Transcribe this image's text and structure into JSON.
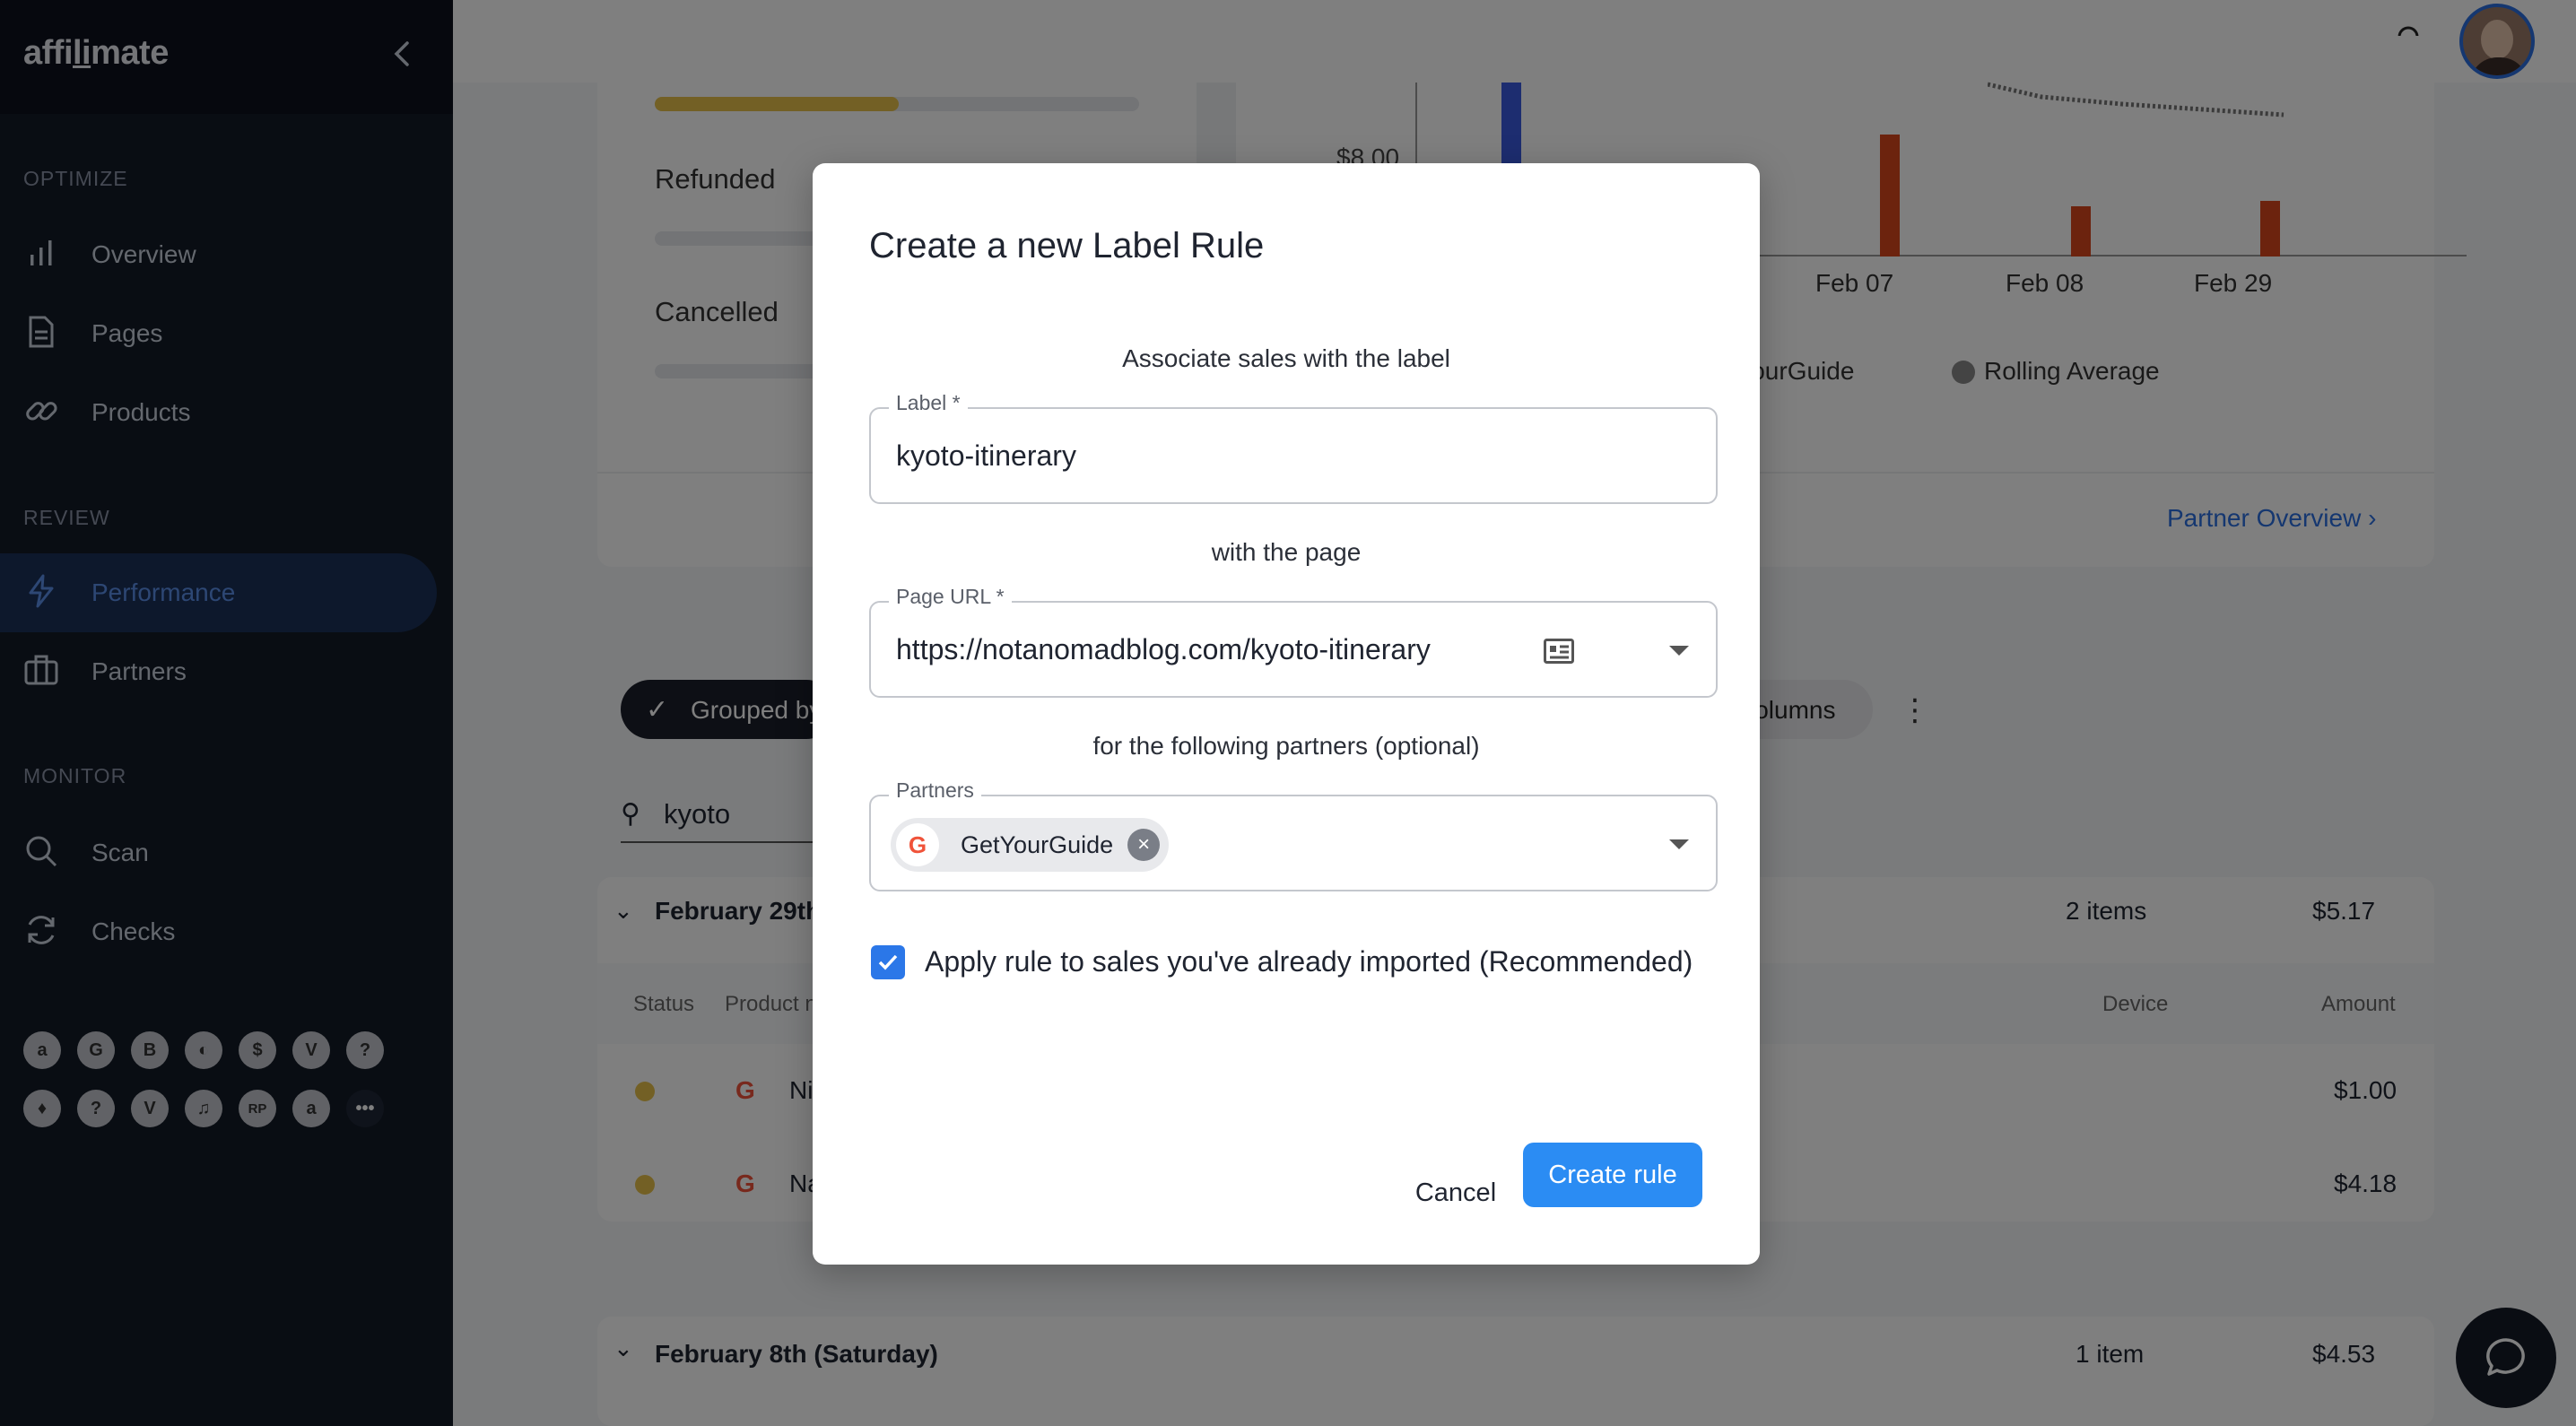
{
  "app": {
    "logo_prefix": "affi",
    "logo_underline": "li",
    "logo_suffix": "mate"
  },
  "sidebar": {
    "sections": [
      {
        "title": "OPTIMIZE",
        "items": [
          {
            "label": "Overview",
            "icon": "bar-chart-icon"
          },
          {
            "label": "Pages",
            "icon": "document-icon"
          },
          {
            "label": "Products",
            "icon": "link-icon"
          }
        ]
      },
      {
        "title": "REVIEW",
        "items": [
          {
            "label": "Performance",
            "icon": "bolt-icon",
            "active": true
          },
          {
            "label": "Partners",
            "icon": "briefcase-icon"
          }
        ]
      },
      {
        "title": "MONITOR",
        "items": [
          {
            "label": "Scan",
            "icon": "search-icon"
          },
          {
            "label": "Checks",
            "icon": "refresh-icon"
          }
        ]
      }
    ],
    "partner_icons_row1": [
      "a",
      "G",
      "B",
      "◐",
      "$",
      "V",
      "?"
    ],
    "partner_icons_row2": [
      "♦",
      "?",
      "V",
      "♫",
      "RP",
      "a",
      "•••"
    ]
  },
  "background": {
    "refunded": "Refunded",
    "cancelled": "Cancelled",
    "axis_tick": "$8.00",
    "x_ticks": [
      "Feb 07",
      "Feb 08",
      "Feb 29"
    ],
    "legend": [
      "GetYourGuide",
      "Rolling Average"
    ],
    "partner_overview": "Partner Overview",
    "grouped_by": "Grouped by",
    "columns": "Columns",
    "search_value": "kyoto",
    "group1": {
      "title": "February 29th",
      "count": "2 items",
      "total": "$5.17"
    },
    "table_headers": {
      "status": "Status",
      "product": "Product n",
      "device": "Device",
      "amount": "Amount"
    },
    "rows": [
      {
        "name": "Ni",
        "amount": "$1.00"
      },
      {
        "name": "Na",
        "amount": "$4.18"
      }
    ],
    "group2": {
      "title": "February 8th (Saturday)",
      "count": "1 item",
      "total": "$4.53"
    }
  },
  "dialog": {
    "title": "Create a new Label Rule",
    "text_associate": "Associate sales with the label",
    "label_field": {
      "label": "Label",
      "value": "kyoto-itinerary"
    },
    "text_page": "with the page",
    "url_field": {
      "label": "Page URL",
      "value": "https://notanomadblog.com/kyoto-itinerary"
    },
    "text_partners": "for the following partners (optional)",
    "partners_field": {
      "label": "Partners",
      "chip": "GetYourGuide"
    },
    "checkbox_label": "Apply rule to sales you've already imported (Recommended)",
    "checkbox_checked": true,
    "cancel": "Cancel",
    "create": "Create rule"
  },
  "colors": {
    "accent": "#2b8cf3",
    "sidebar": "#131a27",
    "bar_orange": "#d9461c",
    "bar_blue": "#3a5be0",
    "progress_yellow": "#e6c14a"
  }
}
